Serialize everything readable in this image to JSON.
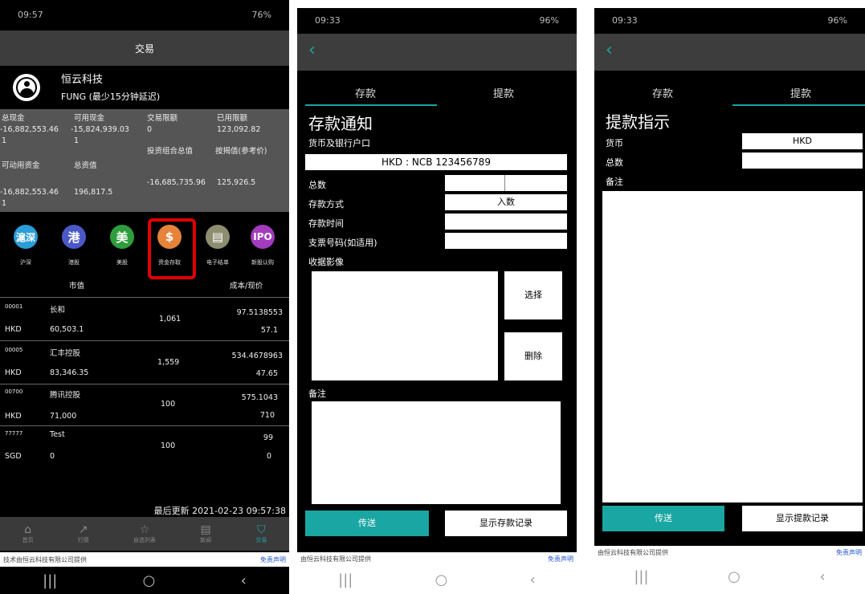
{
  "phone1": {
    "status_time": "09:57",
    "status_right": "76%",
    "title": "交易",
    "company": "恒云科技",
    "account": "FUNG (最少15分钟延迟)",
    "summary": {
      "h1": "总现金",
      "h2": "可用现金",
      "h3": "交易限额",
      "h4": "已用限额",
      "v1": "-16,882,553.46",
      "v1b": "1",
      "v2": "-15,824,939.03",
      "v2b": "1",
      "v3": "0",
      "v4": "123,092.82",
      "h5": "投资组合总值",
      "h6": "按揭值(参考价)",
      "h7": "可动用资金",
      "h8": "总资值",
      "v7": "-16,882,553.46",
      "v7b": "1",
      "v8": "196,817.5",
      "v5": "-16,685,735.96",
      "v6": "125,926.5"
    },
    "icons": [
      {
        "glyph": "滬深",
        "label": "沪深",
        "color": "#2a9ed8",
        "name": "shanghai-shenzhen-icon"
      },
      {
        "glyph": "港",
        "label": "港股",
        "color": "#4a58c8",
        "name": "hongkong-icon"
      },
      {
        "glyph": "美",
        "label": "美股",
        "color": "#2e9e3c",
        "name": "us-stock-icon"
      },
      {
        "glyph": "$",
        "label": "资金存取",
        "color": "#e7823a",
        "name": "fund-transfer-icon"
      },
      {
        "glyph": "▤",
        "label": "电子结单",
        "color": "#8d8d70",
        "name": "statement-icon"
      },
      {
        "glyph": "IPO",
        "label": "新股认购",
        "color": "#a23bbd",
        "name": "ipo-icon"
      }
    ],
    "col_mv": "市值",
    "col_cost": "成本/现价",
    "holdings": [
      {
        "code": "00001",
        "name": "长和",
        "cur": "HKD",
        "mv": "60,503.1",
        "qty": "1,061",
        "cost": "97.5138553",
        "price": "57.1"
      },
      {
        "code": "00005",
        "name": "汇丰控股",
        "cur": "HKD",
        "mv": "83,346.35",
        "qty": "1,559",
        "cost": "534.4678963",
        "price": "47.65"
      },
      {
        "code": "00700",
        "name": "腾讯控股",
        "cur": "HKD",
        "mv": "71,000",
        "qty": "100",
        "cost": "575.1043",
        "price": "710"
      },
      {
        "code": "77777",
        "name": "Test",
        "cur": "SGD",
        "mv": "0",
        "qty": "100",
        "cost": "99",
        "price": "0"
      }
    ],
    "updated": "最后更新 2021-02-23 09:57:38",
    "bottom_tabs": [
      "首页",
      "行情",
      "自选列表",
      "新闻",
      "交易"
    ],
    "footer_left": "技术由恒云科技有限公司提供",
    "footer_right": "免责声明"
  },
  "phone2": {
    "status_time": "09:33",
    "status_right": "96%",
    "tab_deposit": "存款",
    "tab_withdraw": "提款",
    "heading": "存款通知",
    "bank_label": "货币及银行户口",
    "bank_value": "HKD : NCB 123456789",
    "amount_label": "总数",
    "method_label": "存款方式",
    "method_value": "入数",
    "time_label": "存款时间",
    "cheque_label": "支票号码(如适用)",
    "image_label": "收据影像",
    "choose_btn": "选择",
    "delete_btn": "删除",
    "remark_label": "备注",
    "send_btn": "传送",
    "history_btn": "显示存款记录",
    "footer_left": "由恒云科技有限公司提供",
    "footer_right": "免责声明"
  },
  "phone3": {
    "status_time": "09:33",
    "status_right": "96%",
    "tab_deposit": "存款",
    "tab_withdraw": "提款",
    "heading": "提款指示",
    "currency_label": "货币",
    "currency_value": "HKD",
    "amount_label": "总数",
    "remark_label": "备注",
    "send_btn": "传送",
    "history_btn": "显示提款记录",
    "footer_left": "由恒云科技有限公司提供",
    "footer_right": "免责声明"
  },
  "highlight_color": "#e00000"
}
